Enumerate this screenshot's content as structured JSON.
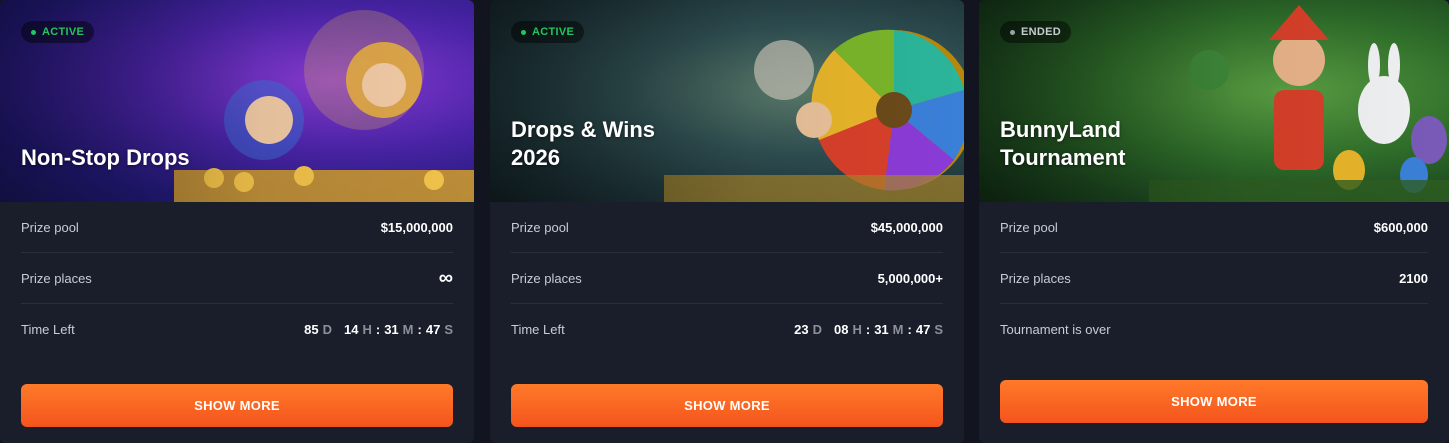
{
  "cards": [
    {
      "status": "ACTIVE",
      "title": "Non-Stop Drops",
      "prize_pool_label": "Prize pool",
      "prize_pool": "$15,000,000",
      "prize_places_label": "Prize places",
      "prize_places": "∞",
      "time_label": "Time Left",
      "time": {
        "d": "85",
        "h": "14",
        "m": "31",
        "s": "47",
        "d_unit": "D",
        "h_unit": "H",
        "m_unit": "M",
        "s_unit": "S"
      },
      "button": "SHOW MORE"
    },
    {
      "status": "ACTIVE",
      "title": "Drops & Wins 2026",
      "prize_pool_label": "Prize pool",
      "prize_pool": "$45,000,000",
      "prize_places_label": "Prize places",
      "prize_places": "5,000,000+",
      "time_label": "Time Left",
      "time": {
        "d": "23",
        "h": "08",
        "m": "31",
        "s": "47",
        "d_unit": "D",
        "h_unit": "H",
        "m_unit": "M",
        "s_unit": "S"
      },
      "button": "SHOW MORE"
    },
    {
      "status": "ENDED",
      "title": "BunnyLand Tournament",
      "prize_pool_label": "Prize pool",
      "prize_pool": "$600,000",
      "prize_places_label": "Prize places",
      "prize_places": "2100",
      "ended_text": "Tournament is over",
      "button": "SHOW MORE"
    }
  ],
  "colors": {
    "accent": "#f4541c",
    "active": "#22c55e",
    "card_bg": "#1a1e2a"
  }
}
